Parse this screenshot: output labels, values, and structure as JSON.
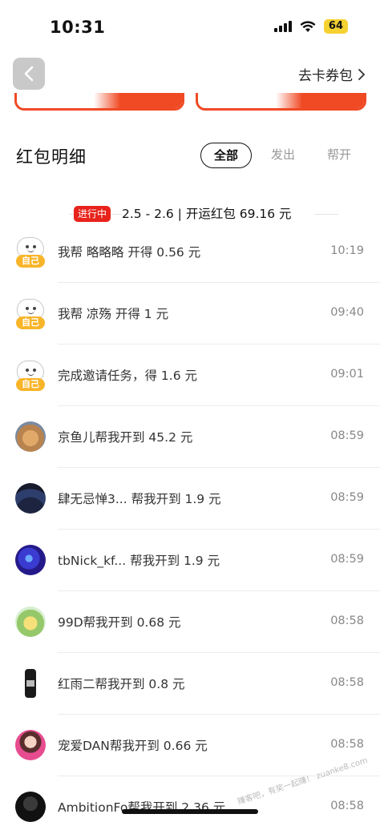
{
  "status_bar": {
    "time": "10:31",
    "battery": "64"
  },
  "header": {
    "wallet_link": "去卡券包",
    "back_icon": "chevron-left-icon",
    "wallet_icon": "chevron-right-icon"
  },
  "section": {
    "title": "红包明细",
    "tabs": [
      {
        "label": "全部",
        "active": true
      },
      {
        "label": "发出",
        "active": false
      },
      {
        "label": "帮开",
        "active": false
      }
    ]
  },
  "period": {
    "badge": "进行中",
    "summary": "2.5 - 2.6 | 开运红包 69.16 元"
  },
  "records": [
    {
      "desc": "我帮  略略略  开得 0.56 元",
      "time": "10:19",
      "self": true,
      "self_tag": "自己"
    },
    {
      "desc": "我帮  凉殇  开得 1 元",
      "time": "09:40",
      "self": true,
      "self_tag": "自己"
    },
    {
      "desc": "完成邀请任务，得 1.6 元",
      "time": "09:01",
      "self": true,
      "self_tag": "自己"
    },
    {
      "desc": "京鱼儿帮我开到 45.2 元",
      "time": "08:59",
      "avatar": "cat-avatar"
    },
    {
      "desc": "肆无忌惮3...  帮我开到 1.9 元",
      "time": "08:59",
      "avatar": "night-sky-avatar"
    },
    {
      "desc": "tbNick_kf...  帮我开到 1.9 元",
      "time": "08:59",
      "avatar": "galaxy-avatar"
    },
    {
      "desc": "99D帮我开到 0.68 元",
      "time": "08:58",
      "avatar": "frog-avatar"
    },
    {
      "desc": "红雨二帮我开到 0.8 元",
      "time": "08:58",
      "avatar": "phone-avatar"
    },
    {
      "desc": "宠爱DAN帮我开到 0.66 元",
      "time": "08:58",
      "avatar": "girl-avatar"
    },
    {
      "desc": "AmbitionFo帮我开到 2.36 元",
      "time": "08:58",
      "avatar": "dark-avatar"
    }
  ],
  "watermark": "赚客吧，有奖一起赚！ zuanke8.com"
}
